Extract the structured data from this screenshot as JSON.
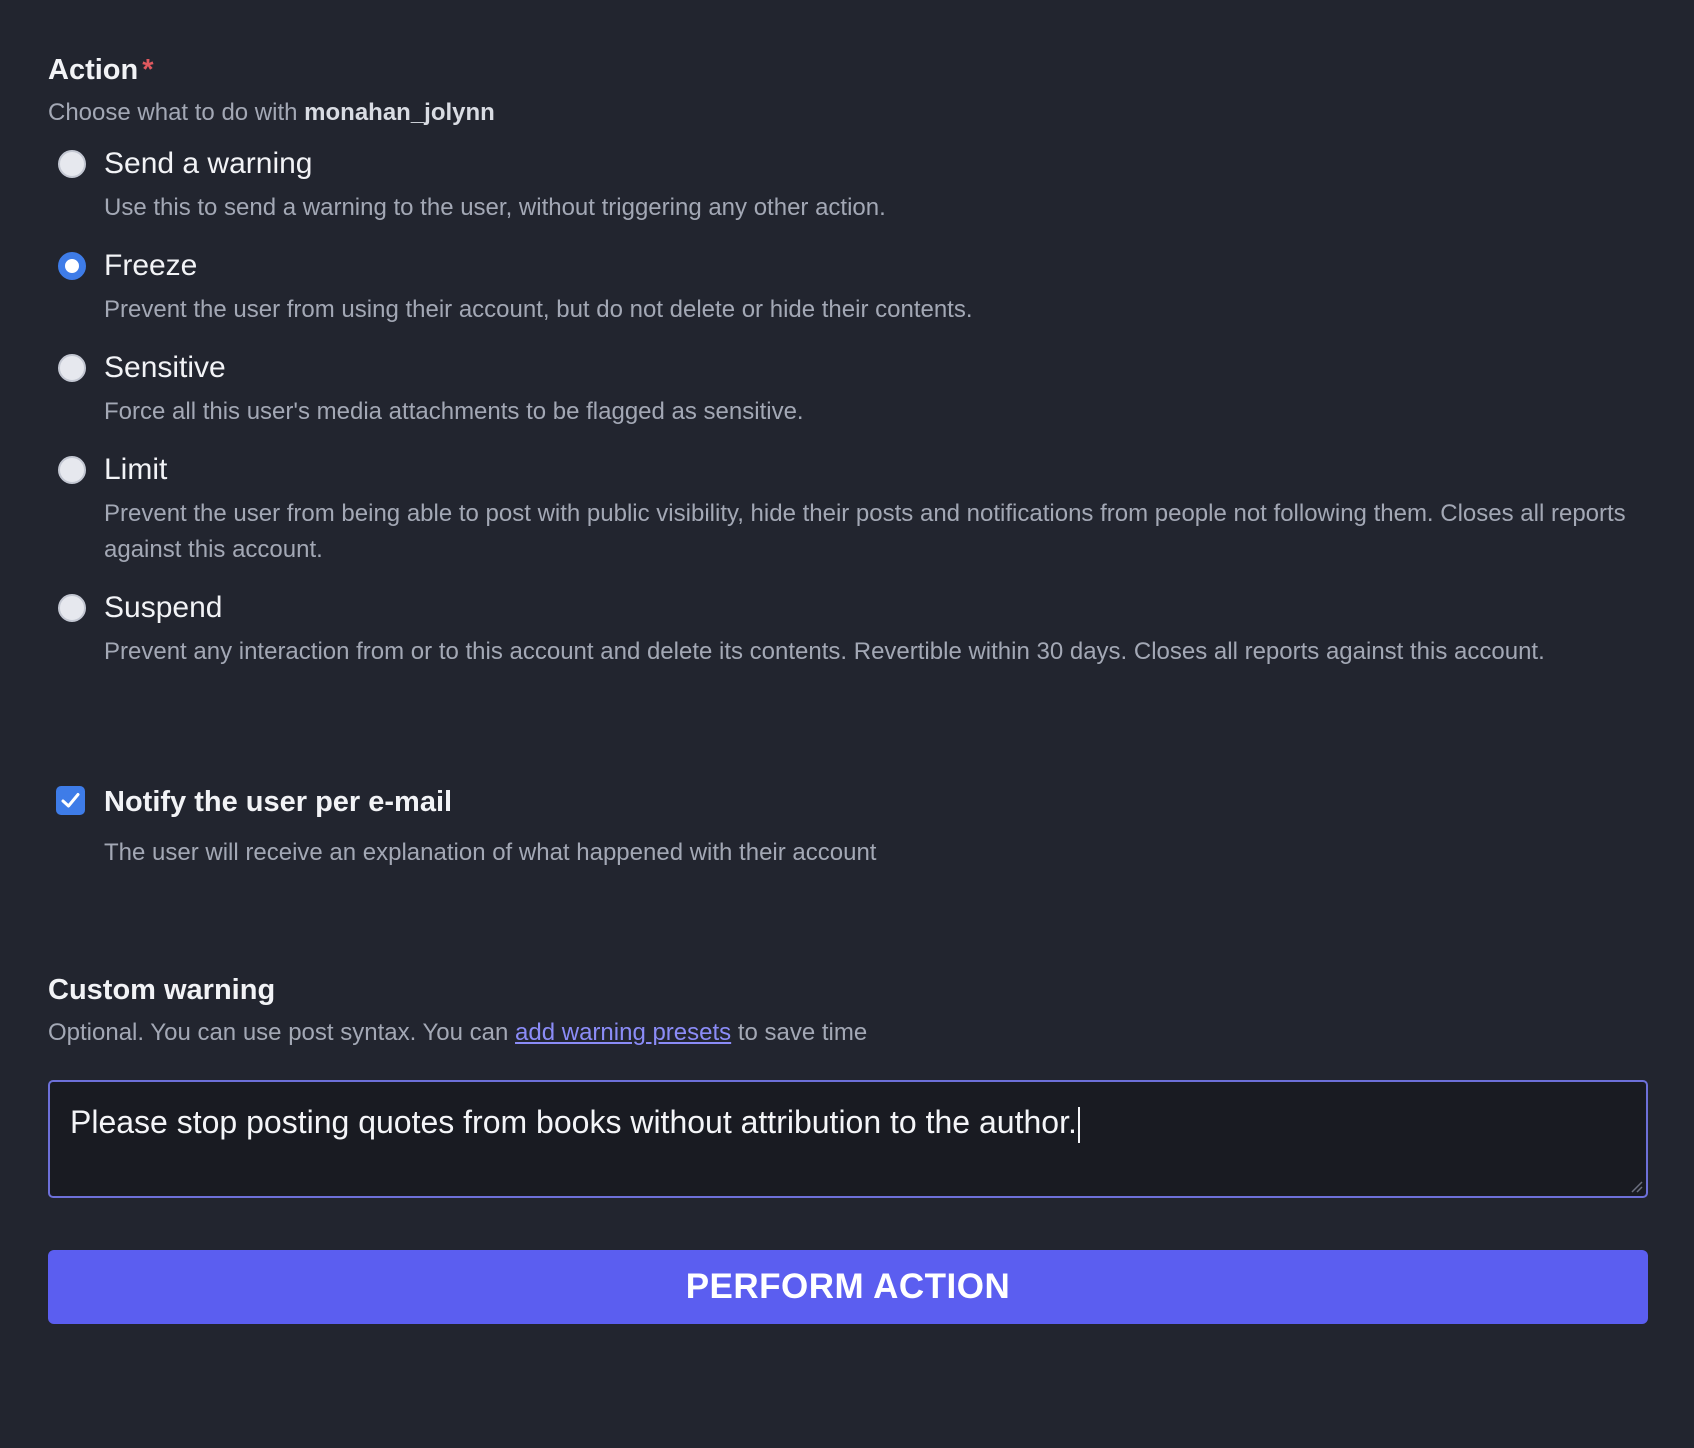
{
  "action": {
    "title": "Action",
    "required_mark": "*",
    "hint_prefix": "Choose what to do with",
    "username": "monahan_jolynn",
    "selected": "freeze",
    "options": [
      {
        "key": "warning",
        "label": "Send a warning",
        "description": "Use this to send a warning to the user, without triggering any other action.",
        "checked": false
      },
      {
        "key": "freeze",
        "label": "Freeze",
        "description": "Prevent the user from using their account, but do not delete or hide their contents.",
        "checked": true
      },
      {
        "key": "sensitive",
        "label": "Sensitive",
        "description": "Force all this user's media attachments to be flagged as sensitive.",
        "checked": false
      },
      {
        "key": "limit",
        "label": "Limit",
        "description": "Prevent the user from being able to post with public visibility, hide their posts and notifications from people not following them. Closes all reports against this account.",
        "checked": false
      },
      {
        "key": "suspend",
        "label": "Suspend",
        "description": "Prevent any interaction from or to this account and delete its contents. Revertible within 30 days. Closes all reports against this account.",
        "checked": false
      }
    ]
  },
  "notify": {
    "label": "Notify the user per e-mail",
    "description": "The user will receive an explanation of what happened with their account",
    "checked": true
  },
  "custom_warning": {
    "title": "Custom warning",
    "hint_prefix": "Optional. You can use post syntax. You can",
    "hint_link": "add warning presets",
    "hint_suffix": "to save time",
    "value": "Please stop posting quotes from books without attribution to the author."
  },
  "submit": {
    "label": "PERFORM ACTION"
  },
  "colors": {
    "background": "#22252f",
    "accent": "#5b5ef0",
    "radio_checked": "#3e7ce8",
    "link": "#8b8cf7",
    "required": "#e0595f"
  }
}
